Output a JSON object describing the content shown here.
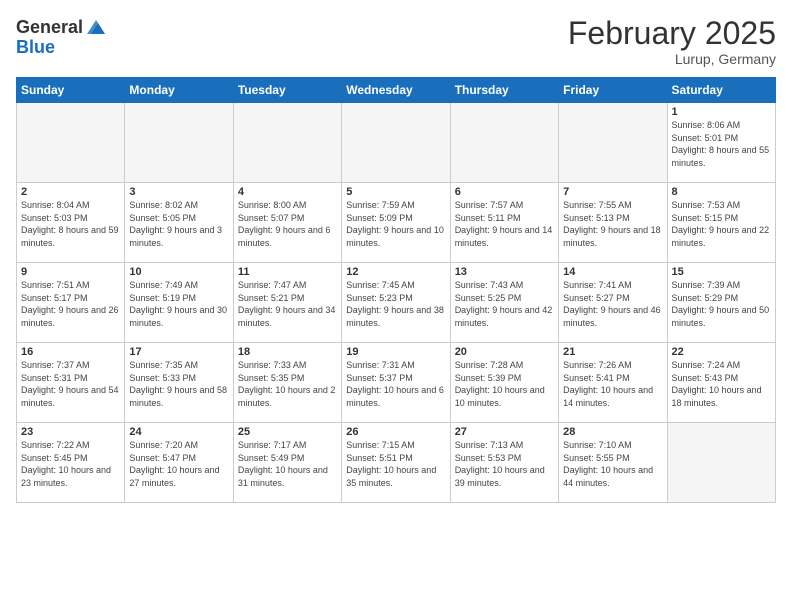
{
  "header": {
    "logo_general": "General",
    "logo_blue": "Blue",
    "month": "February 2025",
    "location": "Lurup, Germany"
  },
  "weekdays": [
    "Sunday",
    "Monday",
    "Tuesday",
    "Wednesday",
    "Thursday",
    "Friday",
    "Saturday"
  ],
  "weeks": [
    [
      {
        "day": "",
        "sunrise": "",
        "sunset": "",
        "daylight": "",
        "empty": true
      },
      {
        "day": "",
        "sunrise": "",
        "sunset": "",
        "daylight": "",
        "empty": true
      },
      {
        "day": "",
        "sunrise": "",
        "sunset": "",
        "daylight": "",
        "empty": true
      },
      {
        "day": "",
        "sunrise": "",
        "sunset": "",
        "daylight": "",
        "empty": true
      },
      {
        "day": "",
        "sunrise": "",
        "sunset": "",
        "daylight": "",
        "empty": true
      },
      {
        "day": "",
        "sunrise": "",
        "sunset": "",
        "daylight": "",
        "empty": true
      },
      {
        "day": "1",
        "sunrise": "Sunrise: 8:06 AM",
        "sunset": "Sunset: 5:01 PM",
        "daylight": "Daylight: 8 hours and 55 minutes.",
        "empty": false
      }
    ],
    [
      {
        "day": "2",
        "sunrise": "Sunrise: 8:04 AM",
        "sunset": "Sunset: 5:03 PM",
        "daylight": "Daylight: 8 hours and 59 minutes.",
        "empty": false
      },
      {
        "day": "3",
        "sunrise": "Sunrise: 8:02 AM",
        "sunset": "Sunset: 5:05 PM",
        "daylight": "Daylight: 9 hours and 3 minutes.",
        "empty": false
      },
      {
        "day": "4",
        "sunrise": "Sunrise: 8:00 AM",
        "sunset": "Sunset: 5:07 PM",
        "daylight": "Daylight: 9 hours and 6 minutes.",
        "empty": false
      },
      {
        "day": "5",
        "sunrise": "Sunrise: 7:59 AM",
        "sunset": "Sunset: 5:09 PM",
        "daylight": "Daylight: 9 hours and 10 minutes.",
        "empty": false
      },
      {
        "day": "6",
        "sunrise": "Sunrise: 7:57 AM",
        "sunset": "Sunset: 5:11 PM",
        "daylight": "Daylight: 9 hours and 14 minutes.",
        "empty": false
      },
      {
        "day": "7",
        "sunrise": "Sunrise: 7:55 AM",
        "sunset": "Sunset: 5:13 PM",
        "daylight": "Daylight: 9 hours and 18 minutes.",
        "empty": false
      },
      {
        "day": "8",
        "sunrise": "Sunrise: 7:53 AM",
        "sunset": "Sunset: 5:15 PM",
        "daylight": "Daylight: 9 hours and 22 minutes.",
        "empty": false
      }
    ],
    [
      {
        "day": "9",
        "sunrise": "Sunrise: 7:51 AM",
        "sunset": "Sunset: 5:17 PM",
        "daylight": "Daylight: 9 hours and 26 minutes.",
        "empty": false
      },
      {
        "day": "10",
        "sunrise": "Sunrise: 7:49 AM",
        "sunset": "Sunset: 5:19 PM",
        "daylight": "Daylight: 9 hours and 30 minutes.",
        "empty": false
      },
      {
        "day": "11",
        "sunrise": "Sunrise: 7:47 AM",
        "sunset": "Sunset: 5:21 PM",
        "daylight": "Daylight: 9 hours and 34 minutes.",
        "empty": false
      },
      {
        "day": "12",
        "sunrise": "Sunrise: 7:45 AM",
        "sunset": "Sunset: 5:23 PM",
        "daylight": "Daylight: 9 hours and 38 minutes.",
        "empty": false
      },
      {
        "day": "13",
        "sunrise": "Sunrise: 7:43 AM",
        "sunset": "Sunset: 5:25 PM",
        "daylight": "Daylight: 9 hours and 42 minutes.",
        "empty": false
      },
      {
        "day": "14",
        "sunrise": "Sunrise: 7:41 AM",
        "sunset": "Sunset: 5:27 PM",
        "daylight": "Daylight: 9 hours and 46 minutes.",
        "empty": false
      },
      {
        "day": "15",
        "sunrise": "Sunrise: 7:39 AM",
        "sunset": "Sunset: 5:29 PM",
        "daylight": "Daylight: 9 hours and 50 minutes.",
        "empty": false
      }
    ],
    [
      {
        "day": "16",
        "sunrise": "Sunrise: 7:37 AM",
        "sunset": "Sunset: 5:31 PM",
        "daylight": "Daylight: 9 hours and 54 minutes.",
        "empty": false
      },
      {
        "day": "17",
        "sunrise": "Sunrise: 7:35 AM",
        "sunset": "Sunset: 5:33 PM",
        "daylight": "Daylight: 9 hours and 58 minutes.",
        "empty": false
      },
      {
        "day": "18",
        "sunrise": "Sunrise: 7:33 AM",
        "sunset": "Sunset: 5:35 PM",
        "daylight": "Daylight: 10 hours and 2 minutes.",
        "empty": false
      },
      {
        "day": "19",
        "sunrise": "Sunrise: 7:31 AM",
        "sunset": "Sunset: 5:37 PM",
        "daylight": "Daylight: 10 hours and 6 minutes.",
        "empty": false
      },
      {
        "day": "20",
        "sunrise": "Sunrise: 7:28 AM",
        "sunset": "Sunset: 5:39 PM",
        "daylight": "Daylight: 10 hours and 10 minutes.",
        "empty": false
      },
      {
        "day": "21",
        "sunrise": "Sunrise: 7:26 AM",
        "sunset": "Sunset: 5:41 PM",
        "daylight": "Daylight: 10 hours and 14 minutes.",
        "empty": false
      },
      {
        "day": "22",
        "sunrise": "Sunrise: 7:24 AM",
        "sunset": "Sunset: 5:43 PM",
        "daylight": "Daylight: 10 hours and 18 minutes.",
        "empty": false
      }
    ],
    [
      {
        "day": "23",
        "sunrise": "Sunrise: 7:22 AM",
        "sunset": "Sunset: 5:45 PM",
        "daylight": "Daylight: 10 hours and 23 minutes.",
        "empty": false
      },
      {
        "day": "24",
        "sunrise": "Sunrise: 7:20 AM",
        "sunset": "Sunset: 5:47 PM",
        "daylight": "Daylight: 10 hours and 27 minutes.",
        "empty": false
      },
      {
        "day": "25",
        "sunrise": "Sunrise: 7:17 AM",
        "sunset": "Sunset: 5:49 PM",
        "daylight": "Daylight: 10 hours and 31 minutes.",
        "empty": false
      },
      {
        "day": "26",
        "sunrise": "Sunrise: 7:15 AM",
        "sunset": "Sunset: 5:51 PM",
        "daylight": "Daylight: 10 hours and 35 minutes.",
        "empty": false
      },
      {
        "day": "27",
        "sunrise": "Sunrise: 7:13 AM",
        "sunset": "Sunset: 5:53 PM",
        "daylight": "Daylight: 10 hours and 39 minutes.",
        "empty": false
      },
      {
        "day": "28",
        "sunrise": "Sunrise: 7:10 AM",
        "sunset": "Sunset: 5:55 PM",
        "daylight": "Daylight: 10 hours and 44 minutes.",
        "empty": false
      },
      {
        "day": "",
        "sunrise": "",
        "sunset": "",
        "daylight": "",
        "empty": true
      }
    ]
  ]
}
